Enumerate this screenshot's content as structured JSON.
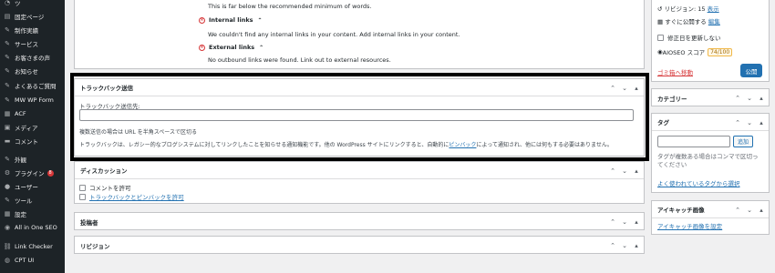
{
  "sidebar": {
    "items": [
      {
        "label": "ツ",
        "icon": "dashboard-icon"
      },
      {
        "label": "固定ページ",
        "icon": "page-icon"
      },
      {
        "label": "制作実績",
        "icon": "pin-icon"
      },
      {
        "label": "サービス",
        "icon": "pin-icon"
      },
      {
        "label": "お客さまの声",
        "icon": "pin-icon"
      },
      {
        "label": "お知らせ",
        "icon": "pin-icon"
      },
      {
        "label": "よくあるご質問",
        "icon": "pin-icon"
      },
      {
        "label": "MW WP Form",
        "icon": "form-icon"
      },
      {
        "label": "ACF",
        "icon": "grid-icon"
      },
      {
        "label": "メディア",
        "icon": "media-icon"
      },
      {
        "label": "コメント",
        "icon": "comment-icon"
      },
      {
        "label": "外観",
        "icon": "appearance-icon"
      },
      {
        "label": "プラグイン",
        "icon": "plugin-icon",
        "badge": "8"
      },
      {
        "label": "ユーザー",
        "icon": "user-icon"
      },
      {
        "label": "ツール",
        "icon": "tool-icon"
      },
      {
        "label": "設定",
        "icon": "settings-icon"
      },
      {
        "label": "All in One SEO",
        "icon": "aioseo-icon"
      },
      {
        "label": "Link Checker",
        "icon": "link-icon"
      },
      {
        "label": "CPT UI",
        "icon": "cpt-icon"
      }
    ]
  },
  "seo": {
    "words_note": "This is far below the recommended minimum of words.",
    "internal_title": "Internal links",
    "internal_text": "We couldn't find any internal links in your content. Add internal links in your content.",
    "external_title": "External links",
    "external_text": "No outbound links were found. Link out to external resources."
  },
  "trackback": {
    "title": "トラックバック送信",
    "label": "トラックバック送信先:",
    "help1": "複数送信の場合は URL を半角スペースで区切る",
    "help2_before": "トラックバックは、レガシー的なブログシステムに対してリンクしたことを知らせる通知機能です。他の WordPress サイトにリンクすると、自動的に",
    "help2_link": "ピンバック",
    "help2_after": "によって通知され、他には何もする必要はありません。"
  },
  "discussion": {
    "title": "ディスカッション",
    "allow_comments": "コメントを許可",
    "allow_pings": "トラックバックとピンバックを許可"
  },
  "author": {
    "title": "投稿者"
  },
  "revisions": {
    "title": "リビジョン"
  },
  "publish": {
    "revisions_text": "リビジョン: 15",
    "revisions_link": "表示",
    "schedule_text": "すぐに公開する",
    "schedule_link": "編集",
    "no_update_date": "修正日を更新しない",
    "aioseo_label": "AIOSEO スコア",
    "aioseo_score": "74/100",
    "trash_link": "ゴミ箱へ移動",
    "publish_button": "公開"
  },
  "categories": {
    "title": "カテゴリー"
  },
  "tags": {
    "title": "タグ",
    "add_button": "追加",
    "help": "タグが複数ある場合はコンマで区切ってください",
    "popular_link": "よく使われているタグから選択"
  },
  "featured": {
    "title": "アイキャッチ画像",
    "set_link": "アイキャッチ画像を設定"
  },
  "colors": {
    "sidebar_bg": "#1d2327",
    "accent": "#2271b1",
    "error": "#d63638"
  }
}
